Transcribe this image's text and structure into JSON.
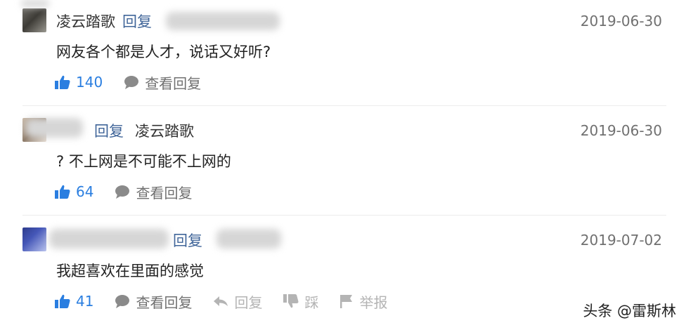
{
  "comments": [
    {
      "author": "凌云踏歌",
      "reply_word": "回复",
      "target_user": "",
      "date": "2019-06-30",
      "text": "网友各个都是人才，说话又好听?",
      "likes": "140",
      "view_replies_label": "查看回复"
    },
    {
      "author": "",
      "reply_word": "回复",
      "target_user": "凌云踏歌",
      "date": "2019-06-30",
      "text": "? 不上网是不可能不上网的",
      "likes": "64",
      "view_replies_label": "查看回复"
    },
    {
      "author": "",
      "reply_word": "回复",
      "target_user": "",
      "date": "2019-07-02",
      "text": "我超喜欢在里面的感觉",
      "likes": "41",
      "view_replies_label": "查看回复",
      "reply_label": "回复",
      "dislike_label": "踩",
      "report_label": "举报"
    }
  ],
  "watermark": "头条 @雷斯林",
  "colors": {
    "accent": "#2a7ee0",
    "link": "#406599",
    "muted": "#707070",
    "disabled": "#b4b4b4"
  },
  "icons": [
    "thumbs-up-icon",
    "chat-bubble-icon",
    "reply-arrow-icon",
    "thumbs-down-icon",
    "flag-icon"
  ]
}
